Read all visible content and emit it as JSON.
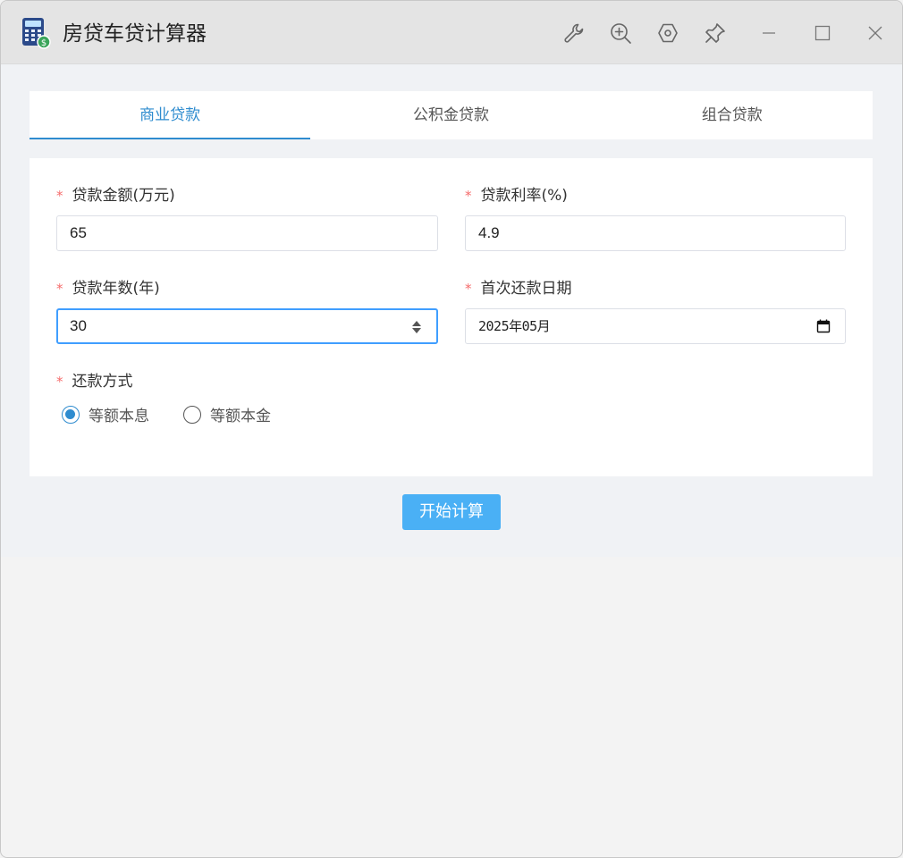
{
  "window": {
    "title": "房贷车贷计算器",
    "toolbar_icons": [
      "wrench-icon",
      "zoom-in-icon",
      "hexagon-settings-icon",
      "pin-icon",
      "minimize-icon",
      "maximize-icon",
      "close-icon"
    ]
  },
  "tabs": [
    {
      "label": "商业贷款",
      "active": true
    },
    {
      "label": "公积金贷款",
      "active": false
    },
    {
      "label": "组合贷款",
      "active": false
    }
  ],
  "form": {
    "required_mark": "*",
    "loan_amount": {
      "label": "贷款金额(万元)",
      "value": "65"
    },
    "interest_rate": {
      "label": "贷款利率(%)",
      "value": "4.9"
    },
    "loan_years": {
      "label": "贷款年数(年)",
      "value": "30"
    },
    "first_payment_date": {
      "label": "首次还款日期",
      "value": "2025年05月"
    },
    "repayment_method": {
      "label": "还款方式",
      "options": [
        {
          "label": "等额本息",
          "checked": true
        },
        {
          "label": "等额本金",
          "checked": false
        }
      ]
    }
  },
  "actions": {
    "calculate_label": "开始计算"
  },
  "colors": {
    "accent": "#2f8ccf",
    "button": "#4ab0f5",
    "required": "#f56c6c",
    "focus": "#409eff"
  }
}
